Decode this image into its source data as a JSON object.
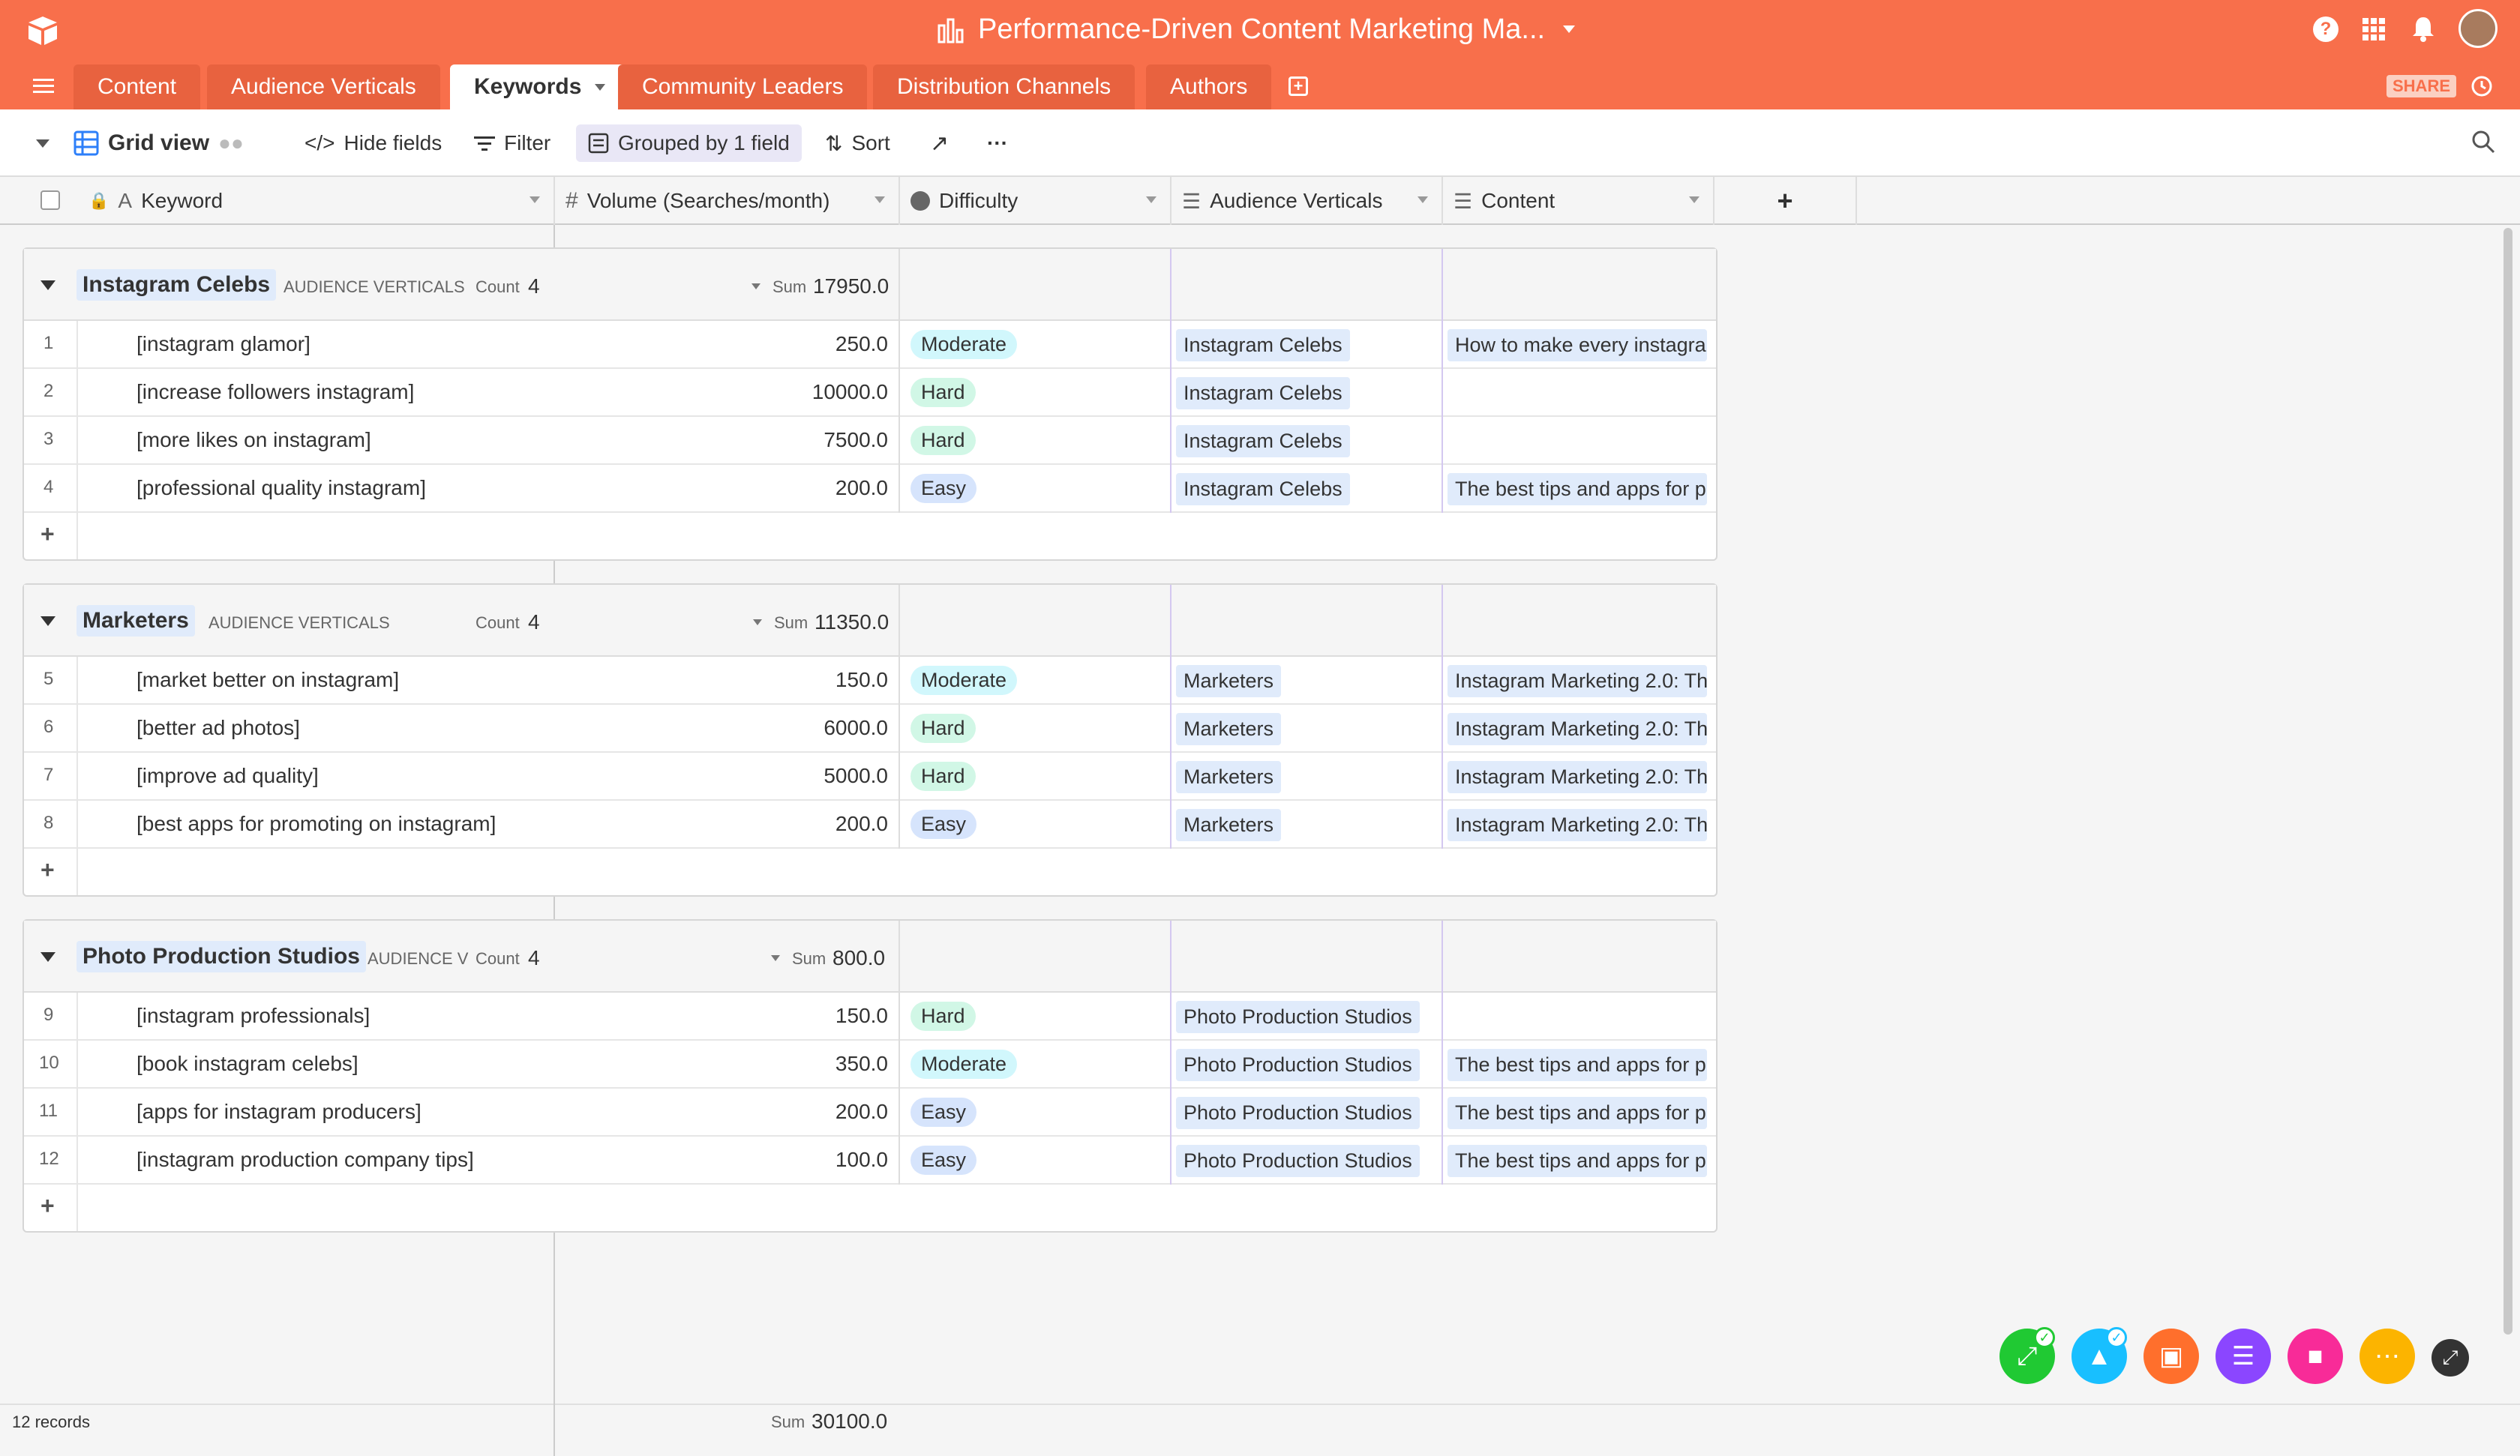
{
  "app": {
    "title": "Performance-Driven Content Marketing Ma...",
    "share_label": "SHARE"
  },
  "tabs": [
    {
      "label": "Content"
    },
    {
      "label": "Audience Verticals"
    },
    {
      "label": "Keywords"
    },
    {
      "label": "Community Leaders"
    },
    {
      "label": "Distribution Channels"
    },
    {
      "label": "Authors"
    }
  ],
  "toolbar": {
    "view_name": "Grid view",
    "hide_fields": "Hide fields",
    "filter": "Filter",
    "grouped": "Grouped by 1 field",
    "sort": "Sort",
    "more": "···"
  },
  "columns": {
    "keyword": "Keyword",
    "volume": "Volume (Searches/month)",
    "difficulty": "Difficulty",
    "audience": "Audience Verticals",
    "content": "Content",
    "add": "+"
  },
  "groups": [
    {
      "name": "Instagram Celebs",
      "field": "AUDIENCE VERTICALS",
      "count_label": "Count",
      "count": "4",
      "sum_label": "Sum",
      "sum": "17950.0",
      "rows": [
        {
          "num": "1",
          "keyword": "[instagram glamor]",
          "volume": "250.0",
          "difficulty": "Moderate",
          "audience": "Instagram Celebs",
          "content": "How to make every instagram"
        },
        {
          "num": "2",
          "keyword": "[increase followers instagram]",
          "volume": "10000.0",
          "difficulty": "Hard",
          "audience": "Instagram Celebs",
          "content": ""
        },
        {
          "num": "3",
          "keyword": "[more likes on instagram]",
          "volume": "7500.0",
          "difficulty": "Hard",
          "audience": "Instagram Celebs",
          "content": ""
        },
        {
          "num": "4",
          "keyword": "[professional quality instagram]",
          "volume": "200.0",
          "difficulty": "Easy",
          "audience": "Instagram Celebs",
          "content": "The best tips and apps for p"
        }
      ]
    },
    {
      "name": "Marketers",
      "field": "AUDIENCE VERTICALS",
      "count_label": "Count",
      "count": "4",
      "sum_label": "Sum",
      "sum": "11350.0",
      "rows": [
        {
          "num": "5",
          "keyword": "[market better on instagram]",
          "volume": "150.0",
          "difficulty": "Moderate",
          "audience": "Marketers",
          "content": "Instagram Marketing 2.0: Th"
        },
        {
          "num": "6",
          "keyword": "[better ad photos]",
          "volume": "6000.0",
          "difficulty": "Hard",
          "audience": "Marketers",
          "content": "Instagram Marketing 2.0: Th"
        },
        {
          "num": "7",
          "keyword": "[improve ad quality]",
          "volume": "5000.0",
          "difficulty": "Hard",
          "audience": "Marketers",
          "content": "Instagram Marketing 2.0: Th"
        },
        {
          "num": "8",
          "keyword": "[best apps for promoting on instagram]",
          "volume": "200.0",
          "difficulty": "Easy",
          "audience": "Marketers",
          "content": "Instagram Marketing 2.0: Th"
        }
      ]
    },
    {
      "name": "Photo Production Studios",
      "field": "AUDIENCE V",
      "count_label": "Count",
      "count": "4",
      "sum_label": "Sum",
      "sum": "800.0",
      "rows": [
        {
          "num": "9",
          "keyword": "[instagram professionals]",
          "volume": "150.0",
          "difficulty": "Hard",
          "audience": "Photo Production Studios",
          "content": ""
        },
        {
          "num": "10",
          "keyword": "[book instagram celebs]",
          "volume": "350.0",
          "difficulty": "Moderate",
          "audience": "Photo Production Studios",
          "content": "The best tips and apps for p"
        },
        {
          "num": "11",
          "keyword": "[apps for instagram producers]",
          "volume": "200.0",
          "difficulty": "Easy",
          "audience": "Photo Production Studios",
          "content": "The best tips and apps for p"
        },
        {
          "num": "12",
          "keyword": "[instagram production company tips]",
          "volume": "100.0",
          "difficulty": "Easy",
          "audience": "Photo Production Studios",
          "content": "The best tips and apps for p"
        }
      ]
    }
  ],
  "footer": {
    "records": "12 records",
    "sum_label": "Sum",
    "sum": "30100.0"
  },
  "colors": {
    "brand": "#f86f4b",
    "moderate": "#d1f7fc",
    "hard": "#d1f7e6",
    "easy": "#d6e4fc"
  }
}
